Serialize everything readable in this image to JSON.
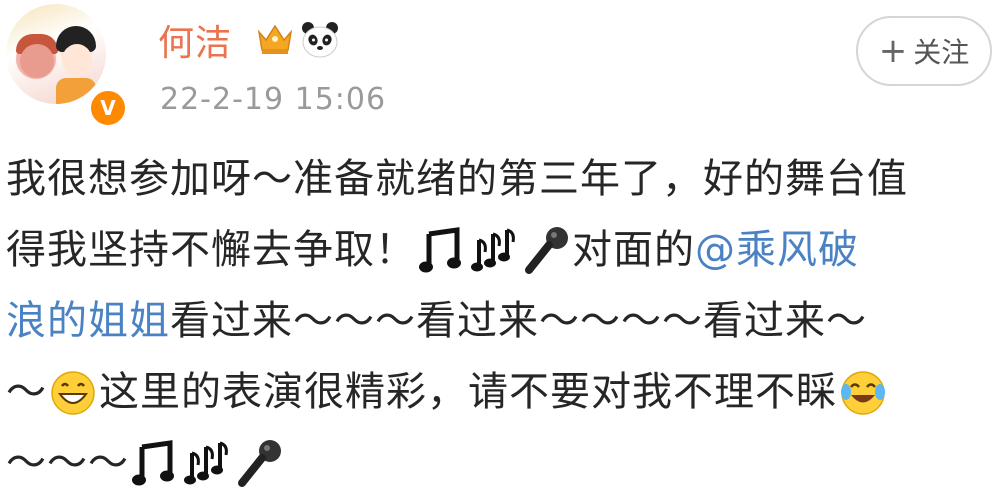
{
  "post": {
    "author": "何洁",
    "timestamp": "22-2-19 15:06",
    "follow_label": "关注",
    "lines": {
      "l1": "我很想参加呀～准备就绪的第三年了，好的舞台值",
      "l2a": "得我坚持不懈去争取！",
      "l2b": "对面的",
      "l2mention": "@乘风破",
      "l3mention": "浪的姐姐",
      "l3b": " 看过来～～～看过来～～～～看过来～",
      "l4a": "～",
      "l4b": "这里的表演很精彩，请不要对我不理不睬",
      "l5a": "～～～"
    }
  },
  "colors": {
    "username": "#eb7350",
    "mention": "#4a82c4",
    "timestamp": "#9a9a9a",
    "verified_badge": "#ff8a00"
  },
  "icons": [
    "crown-icon",
    "panda-icon",
    "verified-icon",
    "music-note-icon",
    "music-notes-icon",
    "microphone-icon",
    "grin-emoji",
    "laugh-cry-emoji"
  ]
}
